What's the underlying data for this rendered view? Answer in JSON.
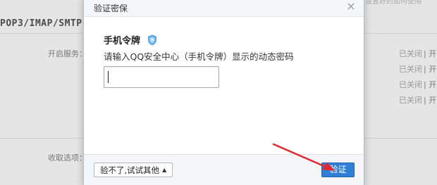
{
  "background": {
    "section_title": "POP3/IMAP/SMTP",
    "service_label": "开启服务：",
    "receive_label": "收取选项：",
    "statuses": [
      "已关闭",
      "已关闭",
      "已关闭",
      "已关闭"
    ],
    "status_suffix": "| 开",
    "top_right_text": "设置好的如何使用"
  },
  "dialog": {
    "title": "验证密保",
    "close_symbol": "×",
    "token_title": "手机令牌",
    "description": "请输入QQ安全中心（手机令牌）显示的动态密码",
    "code_value": "",
    "code_placeholder": "",
    "alt_button_label": "验不了,试试其他",
    "alt_button_caret": "▲",
    "verify_button_label": "验证"
  },
  "colors": {
    "primary_button": "#2f7fd6",
    "annotation_arrow": "#e5262b",
    "shield": "#5ba6e6"
  },
  "icons": [
    "shield-icon",
    "close-icon",
    "caret-up-icon",
    "arrow-annotation"
  ]
}
